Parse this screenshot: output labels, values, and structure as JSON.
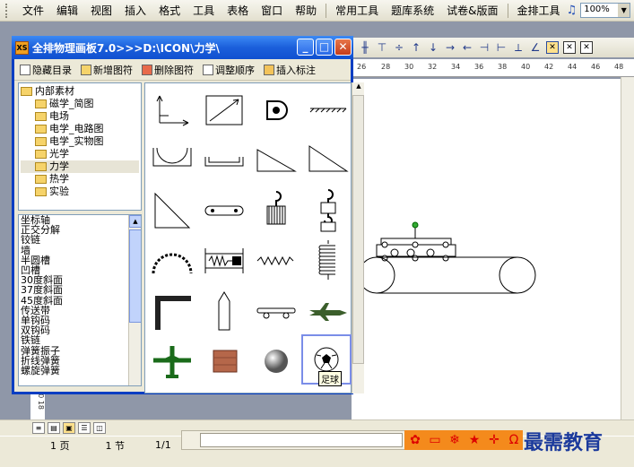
{
  "menubar": {
    "items": [
      "文件",
      "编辑",
      "视图",
      "插入",
      "格式",
      "工具",
      "表格",
      "窗口",
      "帮助"
    ],
    "extra_items": [
      "常用工具",
      "题库系统",
      "试卷&版面",
      "金排工具"
    ],
    "zoom": "100%"
  },
  "dialog": {
    "title": "全排物理画板7.0>>>D:\\ICON\\力学\\",
    "app_icon": "XS",
    "toolbar": [
      "隐藏目录",
      "新增图符",
      "删除图符",
      "调整顺序",
      "插入标注"
    ],
    "tree": {
      "root": "内部素材",
      "children": [
        "磁学_简图",
        "电场",
        "电学_电路图",
        "电学_实物图",
        "光学",
        "力学",
        "热学",
        "实验"
      ]
    },
    "list": [
      "坐标轴",
      "正交分解",
      "铰链",
      "墙",
      "半圆槽",
      "凹槽",
      "30度斜面",
      "37度斜面",
      "45度斜面",
      "传送带",
      "单钩码",
      "双钩码",
      "铁链",
      "弹簧振子",
      "折线弹簧",
      "螺旋弹簧"
    ],
    "tooltip": "足球",
    "grid_icons": [
      "axes-icon",
      "incline-box-icon",
      "pulley-icon",
      "ground-hatch-icon",
      "half-circle-groove-icon",
      "groove-icon",
      "incline-30-icon",
      "incline-37-icon",
      "incline-45-icon",
      "conveyor-small-icon",
      "single-hook-weight-icon",
      "double-hook-weight-icon",
      "chain-icon",
      "spring-oscillator-icon",
      "zigzag-spring-icon",
      "coil-spring-icon",
      "table-icon",
      "rocket-icon",
      "skateboard-icon",
      "fighter-jet-icon",
      "airplane-icon",
      "brick-icon",
      "ball-icon",
      "football-icon"
    ]
  },
  "ruler": [
    "26",
    "28",
    "30",
    "32",
    "34",
    "36",
    "38",
    "40",
    "42",
    "44",
    "46",
    "48"
  ],
  "vruler": "20 18",
  "statusbar": {
    "page": "1 页",
    "section": "1 节",
    "pos": "1/1"
  },
  "brand": "最需教育"
}
